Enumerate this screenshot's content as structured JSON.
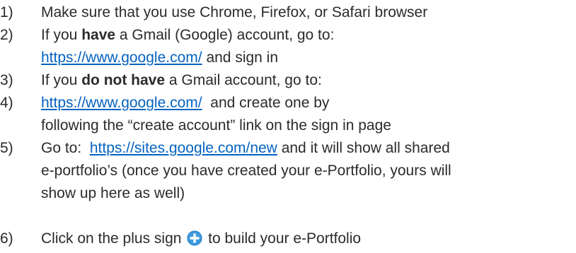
{
  "steps": [
    {
      "number": "1)",
      "text": "Make sure that you use Chrome, Firefox, or Safari browser"
    },
    {
      "number": "2)",
      "prefix": "If you ",
      "bold": "have",
      "suffix": " a Gmail (Google) account, go to:",
      "link": "https://www.google.com/",
      "after_link": " and sign in"
    },
    {
      "number": "3)",
      "prefix": "If you ",
      "bold": "do not have",
      "suffix": " a Gmail account, go to:"
    },
    {
      "number": "4)",
      "link": "https://www.google.com/",
      "after_link": "  and create one by",
      "line2": "following the “create account” link on the sign in page"
    },
    {
      "number": "5)",
      "prefix": "Go to:  ",
      "link": "https://sites.google.com/new",
      "after_link": " and it will show all shared",
      "line2": "e-portfolio’s (once you have created your e-Portfolio, yours will",
      "line3": "show up here as well)"
    },
    {
      "number": "6)",
      "prefix": "Click on the plus sign ",
      "icon": "plus-circle-icon",
      "suffix": " to build your e-Portfolio"
    }
  ],
  "colors": {
    "text": "#2b2b2b",
    "link": "#0563c1",
    "icon_fill": "#3d9be0"
  }
}
